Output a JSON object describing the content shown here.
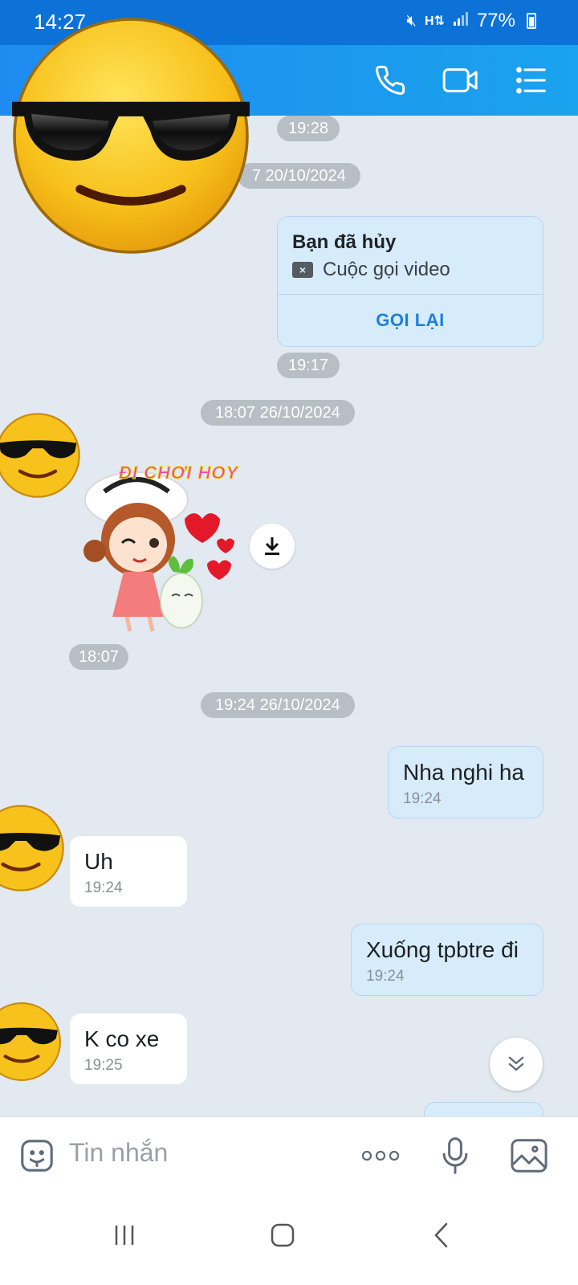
{
  "status_bar": {
    "time": "14:27",
    "battery": "77%"
  },
  "header": {
    "icons": [
      "phone-icon",
      "video-call-icon",
      "menu-list-icon"
    ]
  },
  "messages": {
    "top_time": "19:28",
    "date_1": "7 20/10/2024",
    "call_card": {
      "title": "Bạn đã hủy",
      "subtitle": "Cuộc gọi video",
      "action": "GỌI LẠI",
      "time": "19:17"
    },
    "date_2": "18:07 26/10/2024",
    "sticker": {
      "text": "ĐI CHƠI HOY",
      "time": "18:07"
    },
    "date_3": "19:24 26/10/2024",
    "list": [
      {
        "side": "me",
        "text": "Nha nghi ha",
        "time": "19:24"
      },
      {
        "side": "them",
        "text": "Uh",
        "time": "19:24"
      },
      {
        "side": "me",
        "text": "Xuống tpbtre đi",
        "time": "19:24"
      },
      {
        "side": "them",
        "text": "K co xe",
        "time": "19:25"
      }
    ]
  },
  "input": {
    "placeholder": "Tin nhắn"
  },
  "colors": {
    "header": "#1e8bf0",
    "my_bubble": "#d7ecfb",
    "their_bubble": "#ffffff",
    "background": "#e2e9f1",
    "accent": "#1d7fd8"
  }
}
